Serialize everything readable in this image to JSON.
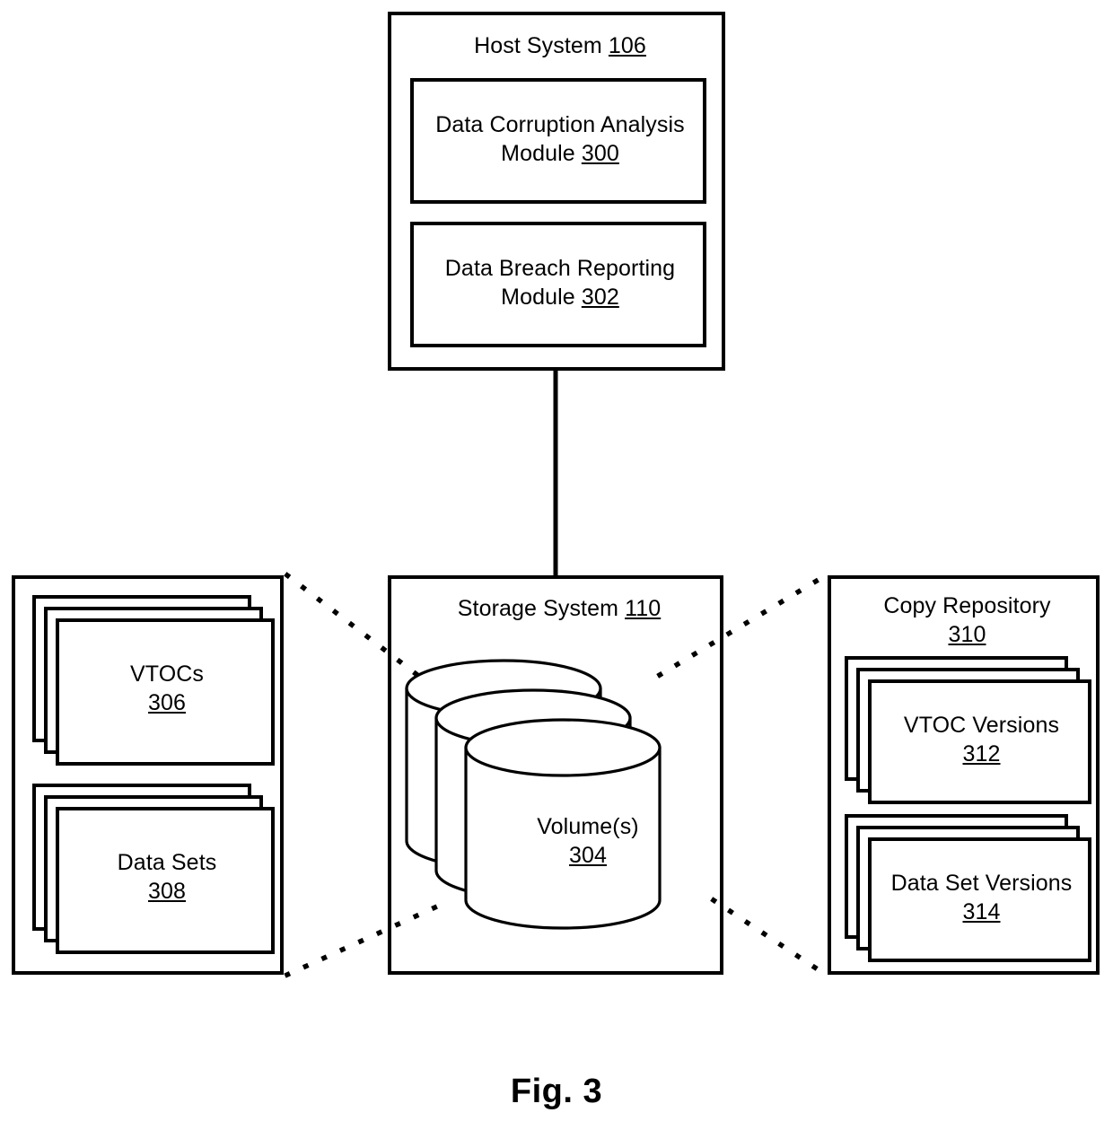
{
  "figure": {
    "caption": "Fig. 3"
  },
  "host_system": {
    "title": "Host System",
    "ref": "106",
    "modules": [
      {
        "title": "Data Corruption Analysis\nModule",
        "ref": "300"
      },
      {
        "title": "Data Breach Reporting\nModule",
        "ref": "302"
      }
    ]
  },
  "storage_system": {
    "title": "Storage System",
    "ref": "110",
    "cylinder": {
      "title": "Volume(s)",
      "ref": "304",
      "count": 3
    }
  },
  "left_panel": {
    "stacks": [
      {
        "title": "VTOCs",
        "ref": "306",
        "sheets": 3
      },
      {
        "title": "Data Sets",
        "ref": "308",
        "sheets": 3
      }
    ]
  },
  "copy_repository": {
    "title": "Copy Repository",
    "ref": "310",
    "stacks": [
      {
        "title": "VTOC Versions",
        "ref": "312",
        "sheets": 3
      },
      {
        "title": "Data Set Versions",
        "ref": "314",
        "sheets": 3
      }
    ]
  },
  "connectors": {
    "host_to_storage": "solid-vertical-line",
    "left_panel_to_storage_top": "dotted-line",
    "left_panel_to_storage_bottom": "dotted-line",
    "storage_to_repository_top": "dotted-line",
    "storage_to_repository_bottom": "dotted-line"
  },
  "colors": {
    "stroke": "#000000",
    "background": "#ffffff"
  }
}
